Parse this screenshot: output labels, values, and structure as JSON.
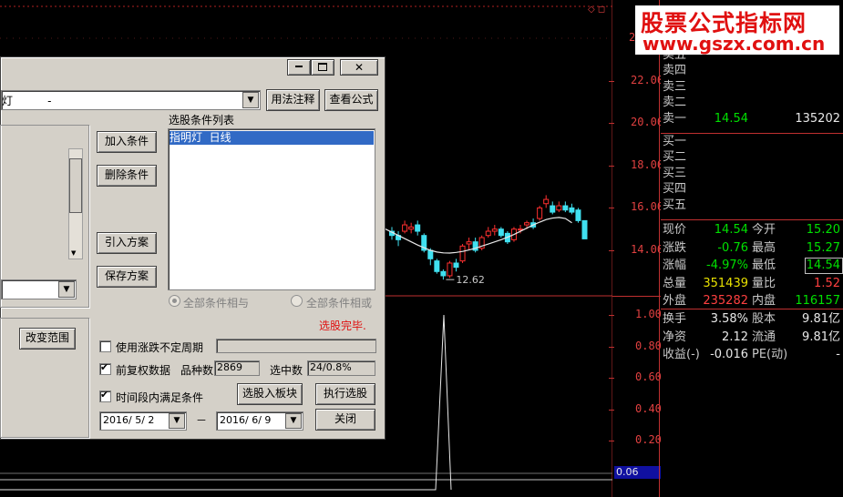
{
  "watermark": {
    "title": "股票公式指标网",
    "url": "www.gszx.com.cn"
  },
  "top_marker": "◇ ◻",
  "price_axis": [
    {
      "label": "22.00",
      "value": 22
    },
    {
      "label": "20.00",
      "value": 20
    },
    {
      "label": "18.00",
      "value": 18
    },
    {
      "label": "16.00",
      "value": 16
    },
    {
      "label": "14.00",
      "value": 14
    }
  ],
  "indicator_axis": [
    {
      "label": "1.00",
      "value": 1.0
    },
    {
      "label": "0.80",
      "value": 0.8
    },
    {
      "label": "0.60",
      "value": 0.6
    },
    {
      "label": "0.40",
      "value": 0.4
    },
    {
      "label": "0.20",
      "value": 0.2
    }
  ],
  "indicator_current": "0.06",
  "low_annotation": "12.62",
  "partial_axis_top": "2",
  "order_book": {
    "sell": [
      {
        "label": "卖五",
        "price": "",
        "vol": ""
      },
      {
        "label": "卖四",
        "price": "",
        "vol": ""
      },
      {
        "label": "卖三",
        "price": "",
        "vol": ""
      },
      {
        "label": "卖二",
        "price": "",
        "vol": ""
      },
      {
        "label": "卖一",
        "price": "14.54",
        "vol": "135202"
      }
    ],
    "buy": [
      {
        "label": "买一",
        "price": "",
        "vol": ""
      },
      {
        "label": "买二",
        "price": "",
        "vol": ""
      },
      {
        "label": "买三",
        "price": "",
        "vol": ""
      },
      {
        "label": "买四",
        "price": "",
        "vol": ""
      },
      {
        "label": "买五",
        "price": "",
        "vol": ""
      }
    ]
  },
  "quote": [
    {
      "l1": "现价",
      "v1": "14.54",
      "c1": "green",
      "l2": "今开",
      "v2": "15.20",
      "c2": "green"
    },
    {
      "l1": "涨跌",
      "v1": "-0.76",
      "c1": "green",
      "l2": "最高",
      "v2": "15.27",
      "c2": "green"
    },
    {
      "l1": "涨幅",
      "v1": "-4.97%",
      "c1": "green",
      "l2": "最低",
      "v2": "14.54",
      "c2": "green"
    },
    {
      "l1": "总量",
      "v1": "351439",
      "c1": "yellow",
      "l2": "量比",
      "v2": "1.52",
      "c2": "red"
    },
    {
      "l1": "外盘",
      "v1": "235282",
      "c1": "red",
      "l2": "内盘",
      "v2": "116157",
      "c2": "green"
    }
  ],
  "fundamentals": [
    {
      "l1": "换手",
      "v1": "3.58%",
      "l2": "股本",
      "v2": "9.81亿"
    },
    {
      "l1": "净资",
      "v1": "2.12",
      "l2": "流通",
      "v2": "9.81亿"
    },
    {
      "l1": "收益(-)",
      "v1": "-0.016",
      "l2": "PE(动)",
      "v2": "-"
    }
  ],
  "dialog": {
    "formula_select": "灯          -",
    "btn_usage": "用法注释",
    "btn_view": "查看公式",
    "btn_add": "加入条件",
    "btn_delete": "删除条件",
    "btn_import": "引入方案",
    "btn_save": "保存方案",
    "list_title": "选股条件列表",
    "list_items": [
      "指明灯  日线"
    ],
    "radio_and": "全部条件相与",
    "radio_or": "全部条件相或",
    "status": "选股完毕.",
    "btn_range": "改变范围",
    "chk_no_limit": "使用涨跌不定周期",
    "chk_adjust": "前复权数据",
    "stock_count_label": "品种数",
    "stock_count": "2869",
    "selected_label": "选中数",
    "selected_value": "24/0.8%",
    "chk_period": "时间段内满足条件",
    "btn_to_block": "选股入板块",
    "btn_execute": "执行选股",
    "date_start": "2016/ 5/ 2",
    "date_sep": "－",
    "date_end": "2016/ 6/ 9",
    "btn_close": "关闭"
  },
  "chart_data": {
    "type": "candlestick",
    "price_range": [
      12,
      23
    ],
    "candles": [
      {
        "o": 14.9,
        "c": 14.7,
        "h": 15.1,
        "l": 14.5
      },
      {
        "o": 14.7,
        "c": 14.5,
        "h": 14.9,
        "l": 14.2
      },
      {
        "o": 14.9,
        "c": 15.2,
        "h": 15.4,
        "l": 14.8
      },
      {
        "o": 15.0,
        "c": 15.1,
        "h": 15.3,
        "l": 14.8
      },
      {
        "o": 15.2,
        "c": 14.9,
        "h": 15.4,
        "l": 14.7
      },
      {
        "o": 14.7,
        "c": 14.0,
        "h": 14.8,
        "l": 13.9
      },
      {
        "o": 14.0,
        "c": 13.6,
        "h": 14.1,
        "l": 13.3
      },
      {
        "o": 13.5,
        "c": 13.0,
        "h": 13.6,
        "l": 12.9
      },
      {
        "o": 13.0,
        "c": 12.8,
        "h": 13.1,
        "l": 12.62
      },
      {
        "o": 12.8,
        "c": 13.4,
        "h": 13.5,
        "l": 12.7
      },
      {
        "o": 13.4,
        "c": 13.2,
        "h": 13.6,
        "l": 13.0
      },
      {
        "o": 13.5,
        "c": 14.2,
        "h": 14.3,
        "l": 13.4
      },
      {
        "o": 14.3,
        "c": 14.4,
        "h": 14.6,
        "l": 14.0
      },
      {
        "o": 14.4,
        "c": 14.0,
        "h": 14.6,
        "l": 13.9
      },
      {
        "o": 14.1,
        "c": 14.6,
        "h": 14.7,
        "l": 14.0
      },
      {
        "o": 14.7,
        "c": 14.9,
        "h": 15.1,
        "l": 14.6
      },
      {
        "o": 14.9,
        "c": 15.0,
        "h": 15.2,
        "l": 14.7
      },
      {
        "o": 15.0,
        "c": 14.7,
        "h": 15.1,
        "l": 14.6
      },
      {
        "o": 14.8,
        "c": 14.4,
        "h": 14.9,
        "l": 14.3
      },
      {
        "o": 14.5,
        "c": 15.0,
        "h": 15.1,
        "l": 14.4
      },
      {
        "o": 15.0,
        "c": 15.0,
        "h": 15.2,
        "l": 14.8
      },
      {
        "o": 15.2,
        "c": 15.3,
        "h": 15.4,
        "l": 15.0
      },
      {
        "o": 15.3,
        "c": 15.1,
        "h": 15.5,
        "l": 15.0
      },
      {
        "o": 15.5,
        "c": 16.0,
        "h": 16.1,
        "l": 15.4
      },
      {
        "o": 16.2,
        "c": 16.4,
        "h": 16.6,
        "l": 16.0
      },
      {
        "o": 16.1,
        "c": 15.8,
        "h": 16.3,
        "l": 15.7
      },
      {
        "o": 15.9,
        "c": 16.1,
        "h": 16.3,
        "l": 15.8
      },
      {
        "o": 16.1,
        "c": 15.9,
        "h": 16.3,
        "l": 15.8
      },
      {
        "o": 16.0,
        "c": 15.8,
        "h": 16.2,
        "l": 15.7
      },
      {
        "o": 15.9,
        "c": 15.4,
        "h": 16.0,
        "l": 15.3
      },
      {
        "o": 15.4,
        "c": 14.54,
        "h": 15.27,
        "l": 14.54
      }
    ],
    "ma": [
      15.15,
      15.0,
      14.85,
      14.7,
      14.55,
      14.4,
      14.25,
      14.12,
      14.0,
      13.92,
      13.88,
      13.87,
      13.9,
      13.95,
      14.02,
      14.1,
      14.2,
      14.3,
      14.4,
      14.5,
      14.62,
      14.75,
      14.9,
      15.05,
      15.2,
      15.33,
      15.45,
      15.52,
      15.55,
      15.5,
      15.3
    ],
    "indicator": {
      "range": [
        0,
        1.1
      ],
      "spike_value": 1.0,
      "baseline": 0.06
    }
  }
}
